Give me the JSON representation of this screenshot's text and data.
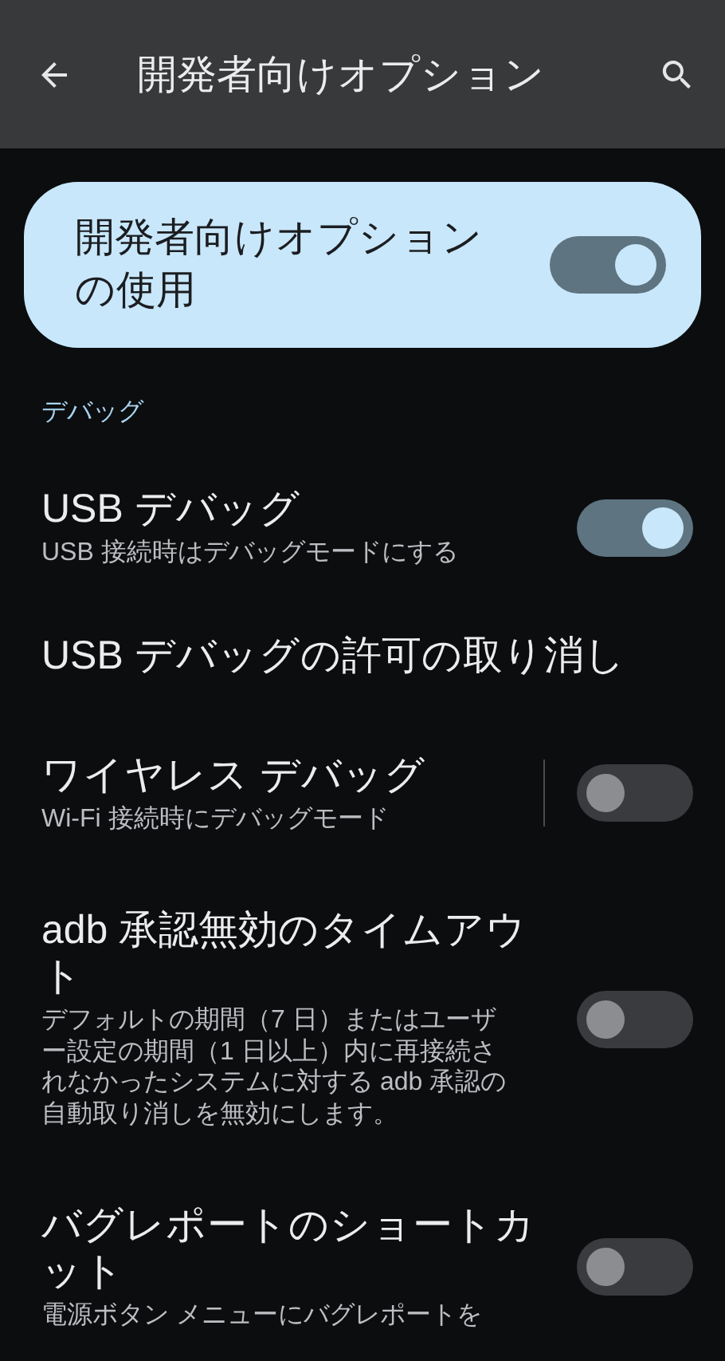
{
  "app_bar": {
    "title": "開発者向けオプション"
  },
  "main_switch": {
    "label": "開発者向けオプションの使用",
    "on": true
  },
  "section": {
    "title": "デバッグ"
  },
  "items": [
    {
      "kind": "switch",
      "title": "USB デバッグ",
      "summary": "USB 接続時はデバッグモードにする",
      "on": true,
      "divider": false
    },
    {
      "kind": "plain",
      "title": "USB デバッグの許可の取り消し"
    },
    {
      "kind": "switch",
      "title": "ワイヤレス デバッグ",
      "summary": "Wi-Fi 接続時にデバッグモード",
      "on": false,
      "divider": true
    },
    {
      "kind": "switch",
      "title": "adb 承認無効のタイムアウト",
      "summary": "デフォルトの期間（7 日）またはユーザー設定の期間（1 日以上）内に再接続されなかったシステムに対する adb 承認の自動取り消しを無効にします。",
      "on": false,
      "divider": false
    },
    {
      "kind": "switch",
      "title": "バグレポートのショートカット",
      "summary": "電源ボタン メニューにバグレポートを",
      "on": false,
      "divider": false
    }
  ]
}
